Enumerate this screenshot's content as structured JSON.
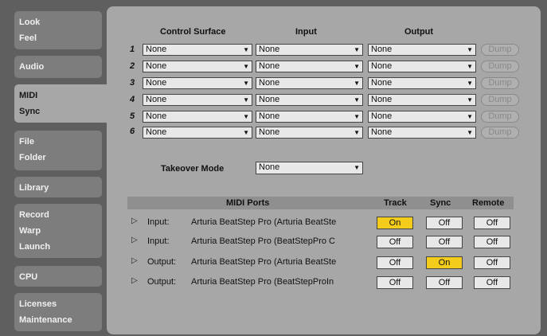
{
  "sidebar": {
    "tabs": [
      {
        "lines": [
          "Look",
          "Feel"
        ]
      },
      {
        "lines": [
          "Audio"
        ]
      },
      {
        "lines": [
          "MIDI",
          "Sync"
        ],
        "active": true
      },
      {
        "lines": [
          "File",
          "Folder"
        ]
      },
      {
        "lines": [
          "Library"
        ]
      },
      {
        "lines": [
          "Record",
          "Warp",
          "Launch"
        ]
      },
      {
        "lines": [
          "CPU"
        ]
      },
      {
        "lines": [
          "Licenses",
          "Maintenance"
        ]
      }
    ]
  },
  "surfaces": {
    "headers": {
      "control_surface": "Control Surface",
      "input": "Input",
      "output": "Output"
    },
    "rows": [
      {
        "num": "1",
        "control_surface": "None",
        "input": "None",
        "output": "None",
        "dump": "Dump"
      },
      {
        "num": "2",
        "control_surface": "None",
        "input": "None",
        "output": "None",
        "dump": "Dump"
      },
      {
        "num": "3",
        "control_surface": "None",
        "input": "None",
        "output": "None",
        "dump": "Dump"
      },
      {
        "num": "4",
        "control_surface": "None",
        "input": "None",
        "output": "None",
        "dump": "Dump"
      },
      {
        "num": "5",
        "control_surface": "None",
        "input": "None",
        "output": "None",
        "dump": "Dump"
      },
      {
        "num": "6",
        "control_surface": "None",
        "input": "None",
        "output": "None",
        "dump": "Dump"
      }
    ]
  },
  "takeover": {
    "label": "Takeover Mode",
    "value": "None"
  },
  "ports": {
    "headers": {
      "ports": "MIDI Ports",
      "track": "Track",
      "sync": "Sync",
      "remote": "Remote"
    },
    "rows": [
      {
        "kind": "Input:",
        "name": "Arturia BeatStep Pro (Arturia BeatSte",
        "track": "On",
        "sync": "Off",
        "remote": "Off",
        "track_on": true,
        "sync_on": false
      },
      {
        "kind": "Input:",
        "name": "Arturia BeatStep Pro (BeatStepPro C",
        "track": "Off",
        "sync": "Off",
        "remote": "Off",
        "track_on": false,
        "sync_on": false
      },
      {
        "kind": "Output:",
        "name": "Arturia BeatStep Pro (Arturia BeatSte",
        "track": "Off",
        "sync": "On",
        "remote": "Off",
        "track_on": false,
        "sync_on": true
      },
      {
        "kind": "Output:",
        "name": "Arturia BeatStep Pro (BeatStepProIn",
        "track": "Off",
        "sync": "Off",
        "remote": "Off",
        "track_on": false,
        "sync_on": false
      }
    ]
  },
  "colors": {
    "on": "#f3cc1c",
    "panel": "#a7a7a7",
    "background": "#5f5f5f"
  }
}
